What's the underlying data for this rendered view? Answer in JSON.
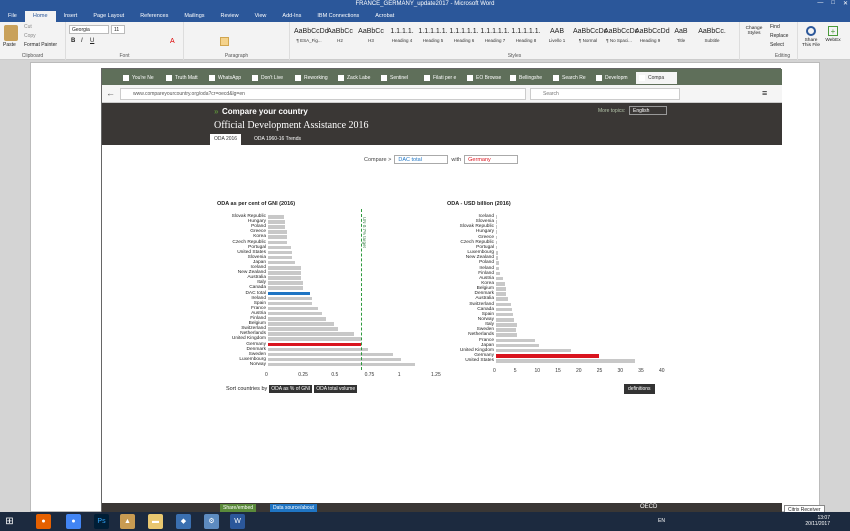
{
  "window": {
    "title": "FRANCE_GERMANY_update2017 - Microsoft Word"
  },
  "ribbon": {
    "tabs": [
      "File",
      "Home",
      "Insert",
      "Page Layout",
      "References",
      "Mailings",
      "Review",
      "View",
      "Add-Ins",
      "IBM Connections",
      "Acrobat"
    ],
    "clipboard": {
      "paste": "Paste",
      "cut": "Cut",
      "copy": "Copy",
      "format_painter": "Format Painter",
      "label": "Clipboard"
    },
    "font": {
      "name": "Georgia",
      "size": "11",
      "label": "Font"
    },
    "paragraph_label": "Paragraph",
    "styles": [
      {
        "preview": "AaBbCcDd",
        "name": "¶ ESA_Fig..."
      },
      {
        "preview": "AaBbCc",
        "name": "H2"
      },
      {
        "preview": "AaBbCc",
        "name": "H3"
      },
      {
        "preview": "1.1.1.1.",
        "name": "Heading 4"
      },
      {
        "preview": "1.1.1.1.1.",
        "name": "Heading 5"
      },
      {
        "preview": "1.1.1.1.1.",
        "name": "Heading 6"
      },
      {
        "preview": "1.1.1.1.1.",
        "name": "Heading 7"
      },
      {
        "preview": "1.1.1.1.1.",
        "name": "Heading 8"
      },
      {
        "preview": "AAB",
        "name": "Livello 1"
      },
      {
        "preview": "AaBbCcDc",
        "name": "¶ Normal"
      },
      {
        "preview": "AaBbCcDc",
        "name": "¶ No Spaci..."
      },
      {
        "preview": "AaBbCcDd",
        "name": "Heading 9"
      },
      {
        "preview": "AaB",
        "name": "Title"
      },
      {
        "preview": "AaBbCc.",
        "name": "Subtitle"
      }
    ],
    "styles_label": "Styles",
    "change_styles": "Change Styles",
    "editing": {
      "find": "Find",
      "replace": "Replace",
      "select": "Select",
      "label": "Editing"
    },
    "share": "Share This File",
    "webex": "WebEx"
  },
  "browser": {
    "tabs": [
      "You're Ne",
      "Truth Matt",
      "WhatsApp",
      "Don't Live",
      "Reworking",
      "Zack Labe",
      "Sentinel",
      "Filati per e",
      "EO Browse",
      "Bellingshe",
      "Search Re",
      "Developm",
      "Compa"
    ],
    "url": "www.compareyourcountry.org/oda?cr=oecd&lg=en",
    "search_placeholder": "Search"
  },
  "site": {
    "title": "Compare your country",
    "subtitle": "Official Development Assistance 2016",
    "more_topics": "More topics:",
    "language": "English",
    "tabs": [
      "ODA 2016",
      "ODA 1960-16 Trends"
    ],
    "compare_label": "Compare >",
    "compare_value": "DAC total",
    "with_label": "with",
    "with_value": "Germany",
    "sort_label": "Sort countries by",
    "sort_buttons": [
      "ODA as % of GNI",
      "ODA total volume"
    ],
    "definitions": "definitions",
    "footer": {
      "share": "Share/embed",
      "source": "Data source/about",
      "oecd": "OECD"
    }
  },
  "chart_data": [
    {
      "type": "bar",
      "title": "ODA as per cent of GNI (2016)",
      "categories": [
        "Slovak Republic",
        "Hungary",
        "Poland",
        "Greece",
        "Korea",
        "Czech Republic",
        "Portugal",
        "United States",
        "Slovenia",
        "Japan",
        "Iceland",
        "New Zealand",
        "Australia",
        "Italy",
        "Canada",
        "DAC total",
        "Ireland",
        "Spain",
        "France",
        "Austria",
        "Finland",
        "Belgium",
        "Switzerland",
        "Netherlands",
        "United Kingdom",
        "Germany",
        "Denmark",
        "Sweden",
        "Luxembourg",
        "Norway"
      ],
      "values": [
        0.12,
        0.13,
        0.13,
        0.14,
        0.14,
        0.14,
        0.17,
        0.18,
        0.18,
        0.2,
        0.25,
        0.25,
        0.25,
        0.26,
        0.26,
        0.32,
        0.33,
        0.33,
        0.38,
        0.41,
        0.44,
        0.5,
        0.53,
        0.65,
        0.7,
        0.7,
        0.75,
        0.94,
        1.0,
        1.11
      ],
      "highlight": {
        "DAC total": "#1f75c4",
        "Germany": "#d9141e"
      },
      "reference_line": {
        "value": 0.7,
        "label": "UN 0.7% target"
      },
      "xticks": [
        "0",
        "0.25",
        "0.5",
        "0.75",
        "1",
        "1.25"
      ],
      "xlim": [
        0,
        1.25
      ]
    },
    {
      "type": "bar",
      "title": "ODA - USD billion (2016)",
      "categories": [
        "Iceland",
        "Slovenia",
        "Slovak Republic",
        "Hungary",
        "Greece",
        "Czech Republic",
        "Portugal",
        "Luxembourg",
        "New Zealand",
        "Poland",
        "Ireland",
        "Finland",
        "Austria",
        "Korea",
        "Belgium",
        "Denmark",
        "Australia",
        "Switzerland",
        "Canada",
        "Spain",
        "Norway",
        "Italy",
        "Sweden",
        "Netherlands",
        "France",
        "Japan",
        "United Kingdom",
        "Germany",
        "United States"
      ],
      "values": [
        0.06,
        0.08,
        0.1,
        0.2,
        0.26,
        0.26,
        0.34,
        0.38,
        0.44,
        0.66,
        0.8,
        1.06,
        1.64,
        2.25,
        2.3,
        2.37,
        3.0,
        3.58,
        3.93,
        4.1,
        4.35,
        5.09,
        4.89,
        4.99,
        9.5,
        10.4,
        18.0,
        24.7,
        33.6
      ],
      "highlight": {
        "Germany": "#d9141e"
      },
      "xticks": [
        "0",
        "5",
        "10",
        "15",
        "20",
        "25",
        "30",
        "35",
        "40"
      ],
      "xlim": [
        0,
        40
      ]
    }
  ],
  "taskbar": {
    "time": "13:07",
    "date": "20/11/2017",
    "lang": "EN",
    "citrix": "Citrix Receiver"
  },
  "colors": {
    "word_blue": "#2b579a",
    "site_dark": "#3a3735",
    "bar_gray": "#c8c8c8",
    "accent_green": "#5a8a3a"
  }
}
